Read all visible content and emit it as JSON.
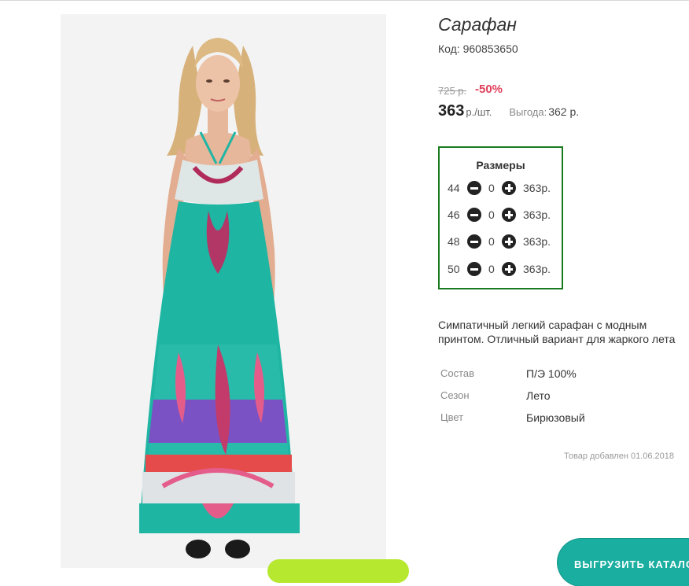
{
  "product": {
    "title": "Сарафан",
    "code": "Код: 960853650",
    "old_price": "725 р.",
    "discount": "-50%",
    "price": "363",
    "unit": "р./шт.",
    "benefit_label": "Выгода:",
    "benefit_value": "362 р.",
    "image_icon": "product-photo-dress"
  },
  "sizes": {
    "title": "Размеры",
    "rows": [
      {
        "size": "44",
        "qty": "0",
        "price": "363р."
      },
      {
        "size": "46",
        "qty": "0",
        "price": "363р."
      },
      {
        "size": "48",
        "qty": "0",
        "price": "363р."
      },
      {
        "size": "50",
        "qty": "0",
        "price": "363р."
      }
    ],
    "border_color": "#1a7a1f"
  },
  "description": "Симпатичный легкий сарафан с модным принтом. Отличный вариант для жаркого лета",
  "properties": [
    {
      "key": "Состав",
      "value": "П/Э 100%"
    },
    {
      "key": "Сезон",
      "value": "Лето"
    },
    {
      "key": "Цвет",
      "value": "Бирюзовый"
    }
  ],
  "added_text": "Товар добавлен 01.06.2018",
  "buttons": {
    "export_label": "ВЫГРУЗИТЬ  КАТАЛОГ",
    "export_color": "#1aaea0",
    "green_color": "#b5e82f"
  },
  "colors": {
    "discount": "#e0405b",
    "dress": "#1fb5a3"
  }
}
